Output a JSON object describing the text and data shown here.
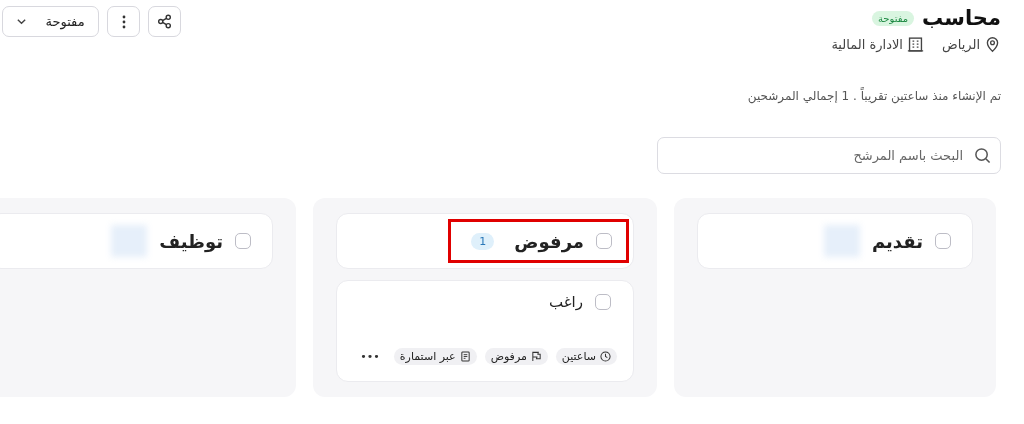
{
  "job": {
    "title": "محاسب",
    "status_badge": "مفتوحة",
    "location": "الرياض",
    "department": "الادارة المالية",
    "summary": "تم الإنشاء منذ ساعتين تقريباً . 1 إجمالي المرشحين"
  },
  "actions": {
    "status_dropdown": "مفتوحة"
  },
  "search": {
    "placeholder": "البحث باسم المرشح"
  },
  "columns": [
    {
      "title": "تقديم",
      "checked": false,
      "highlighted": false
    },
    {
      "title": "مرفوض",
      "checked": false,
      "highlighted": true,
      "count": "1",
      "cards": [
        {
          "name": "راغب",
          "checked": false,
          "tags": [
            {
              "kind": "time",
              "label": "ساعتين"
            },
            {
              "kind": "stage",
              "label": "مرفوض"
            },
            {
              "kind": "source",
              "label": "عبر استمارة"
            }
          ],
          "more": "•••"
        }
      ]
    },
    {
      "title": "توظيف",
      "checked": false,
      "highlighted": false
    }
  ]
}
